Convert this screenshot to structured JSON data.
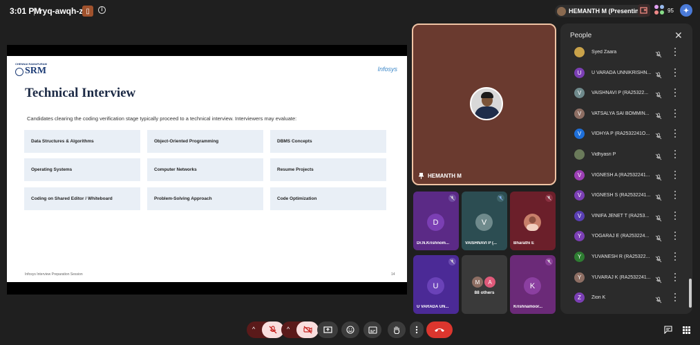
{
  "topbar": {
    "time": "3:01 PM",
    "separator": "|",
    "meeting_code": "ryq-awqh-zka",
    "presenting_label": "HEMANTH M (Presenting)",
    "participant_count": "95"
  },
  "slide": {
    "logo_text": "SRM",
    "logo_top_text": "CHENNAI RAMAPURAM",
    "brand": "Infosys",
    "title": "Technical Interview",
    "description": "Candidates clearing the coding verification stage typically proceed to a technical interview. Interviewers may evaluate:",
    "cards": [
      "Data Structures & Algorithms",
      "Object-Oriented Programming",
      "DBMS Concepts",
      "Operating Systems",
      "Computer Networks",
      "Resume Projects",
      "Coding on Shared Editor / Whiteboard",
      "Problem-Solving Approach",
      "Code Optimization"
    ],
    "footer": "Infosys Interview Preparation Session",
    "page_number": "14"
  },
  "main_tile": {
    "name": "HEMANTH M"
  },
  "tiles": [
    {
      "initial": "D",
      "name": "Dr.N.Krishnom...",
      "bg": "#5b2a86",
      "av": "#7b3fb4"
    },
    {
      "initial": "V",
      "name": "VAISHNAVI P (...",
      "bg": "#2c4d52",
      "av": "#6f8a8c"
    },
    {
      "initial": "",
      "name": "Bharathi E",
      "bg": "#6b1f2a",
      "av": "#c77f6a"
    },
    {
      "initial": "U",
      "name": "U VARADA UN...",
      "bg": "#4b2a96",
      "av": "#6a42b8"
    },
    {
      "initial": "",
      "name": "88 others",
      "bg": "#3a3a3a",
      "av": "#3a3a3a"
    },
    {
      "initial": "K",
      "name": "Krishnamoor...",
      "bg": "#6b2a78",
      "av": "#8b3fa0"
    }
  ],
  "others": {
    "initials": [
      "M",
      "A"
    ],
    "label": "88 others"
  },
  "people_panel": {
    "title": "People",
    "participants": [
      {
        "name": "Syed Zaara",
        "initial": "",
        "color": "#c9a24a"
      },
      {
        "name": "U VARADA UNNIKRISHN...",
        "initial": "U",
        "color": "#7b3fb4"
      },
      {
        "name": "VAISHNAVI P (RA25322...",
        "initial": "V",
        "color": "#6f8a8c"
      },
      {
        "name": "VATSALYA SAI BOMMIN...",
        "initial": "V",
        "color": "#8d6e63"
      },
      {
        "name": "VIDHYA P (RA2532241O...",
        "initial": "V",
        "color": "#1e6fd9"
      },
      {
        "name": "Vidhyasri P",
        "initial": "",
        "color": "#6a7a5a"
      },
      {
        "name": "VIGNESH A (RA2532241...",
        "initial": "V",
        "color": "#9c3fb4"
      },
      {
        "name": "VIGNESH S (RA2532241...",
        "initial": "V",
        "color": "#7b3fb4"
      },
      {
        "name": "VINIFA JENET T (RA253...",
        "initial": "V",
        "color": "#5a3fb4"
      },
      {
        "name": "YOGARAJ E (RA253224...",
        "initial": "Y",
        "color": "#7b3fb4"
      },
      {
        "name": "YUVANESH R (RA25322...",
        "initial": "Y",
        "color": "#2e7d32"
      },
      {
        "name": "YUVARAJ K (RA2532241...",
        "initial": "Y",
        "color": "#8d6e63"
      },
      {
        "name": "Zion K",
        "initial": "Z",
        "color": "#7b3fb4"
      }
    ]
  }
}
